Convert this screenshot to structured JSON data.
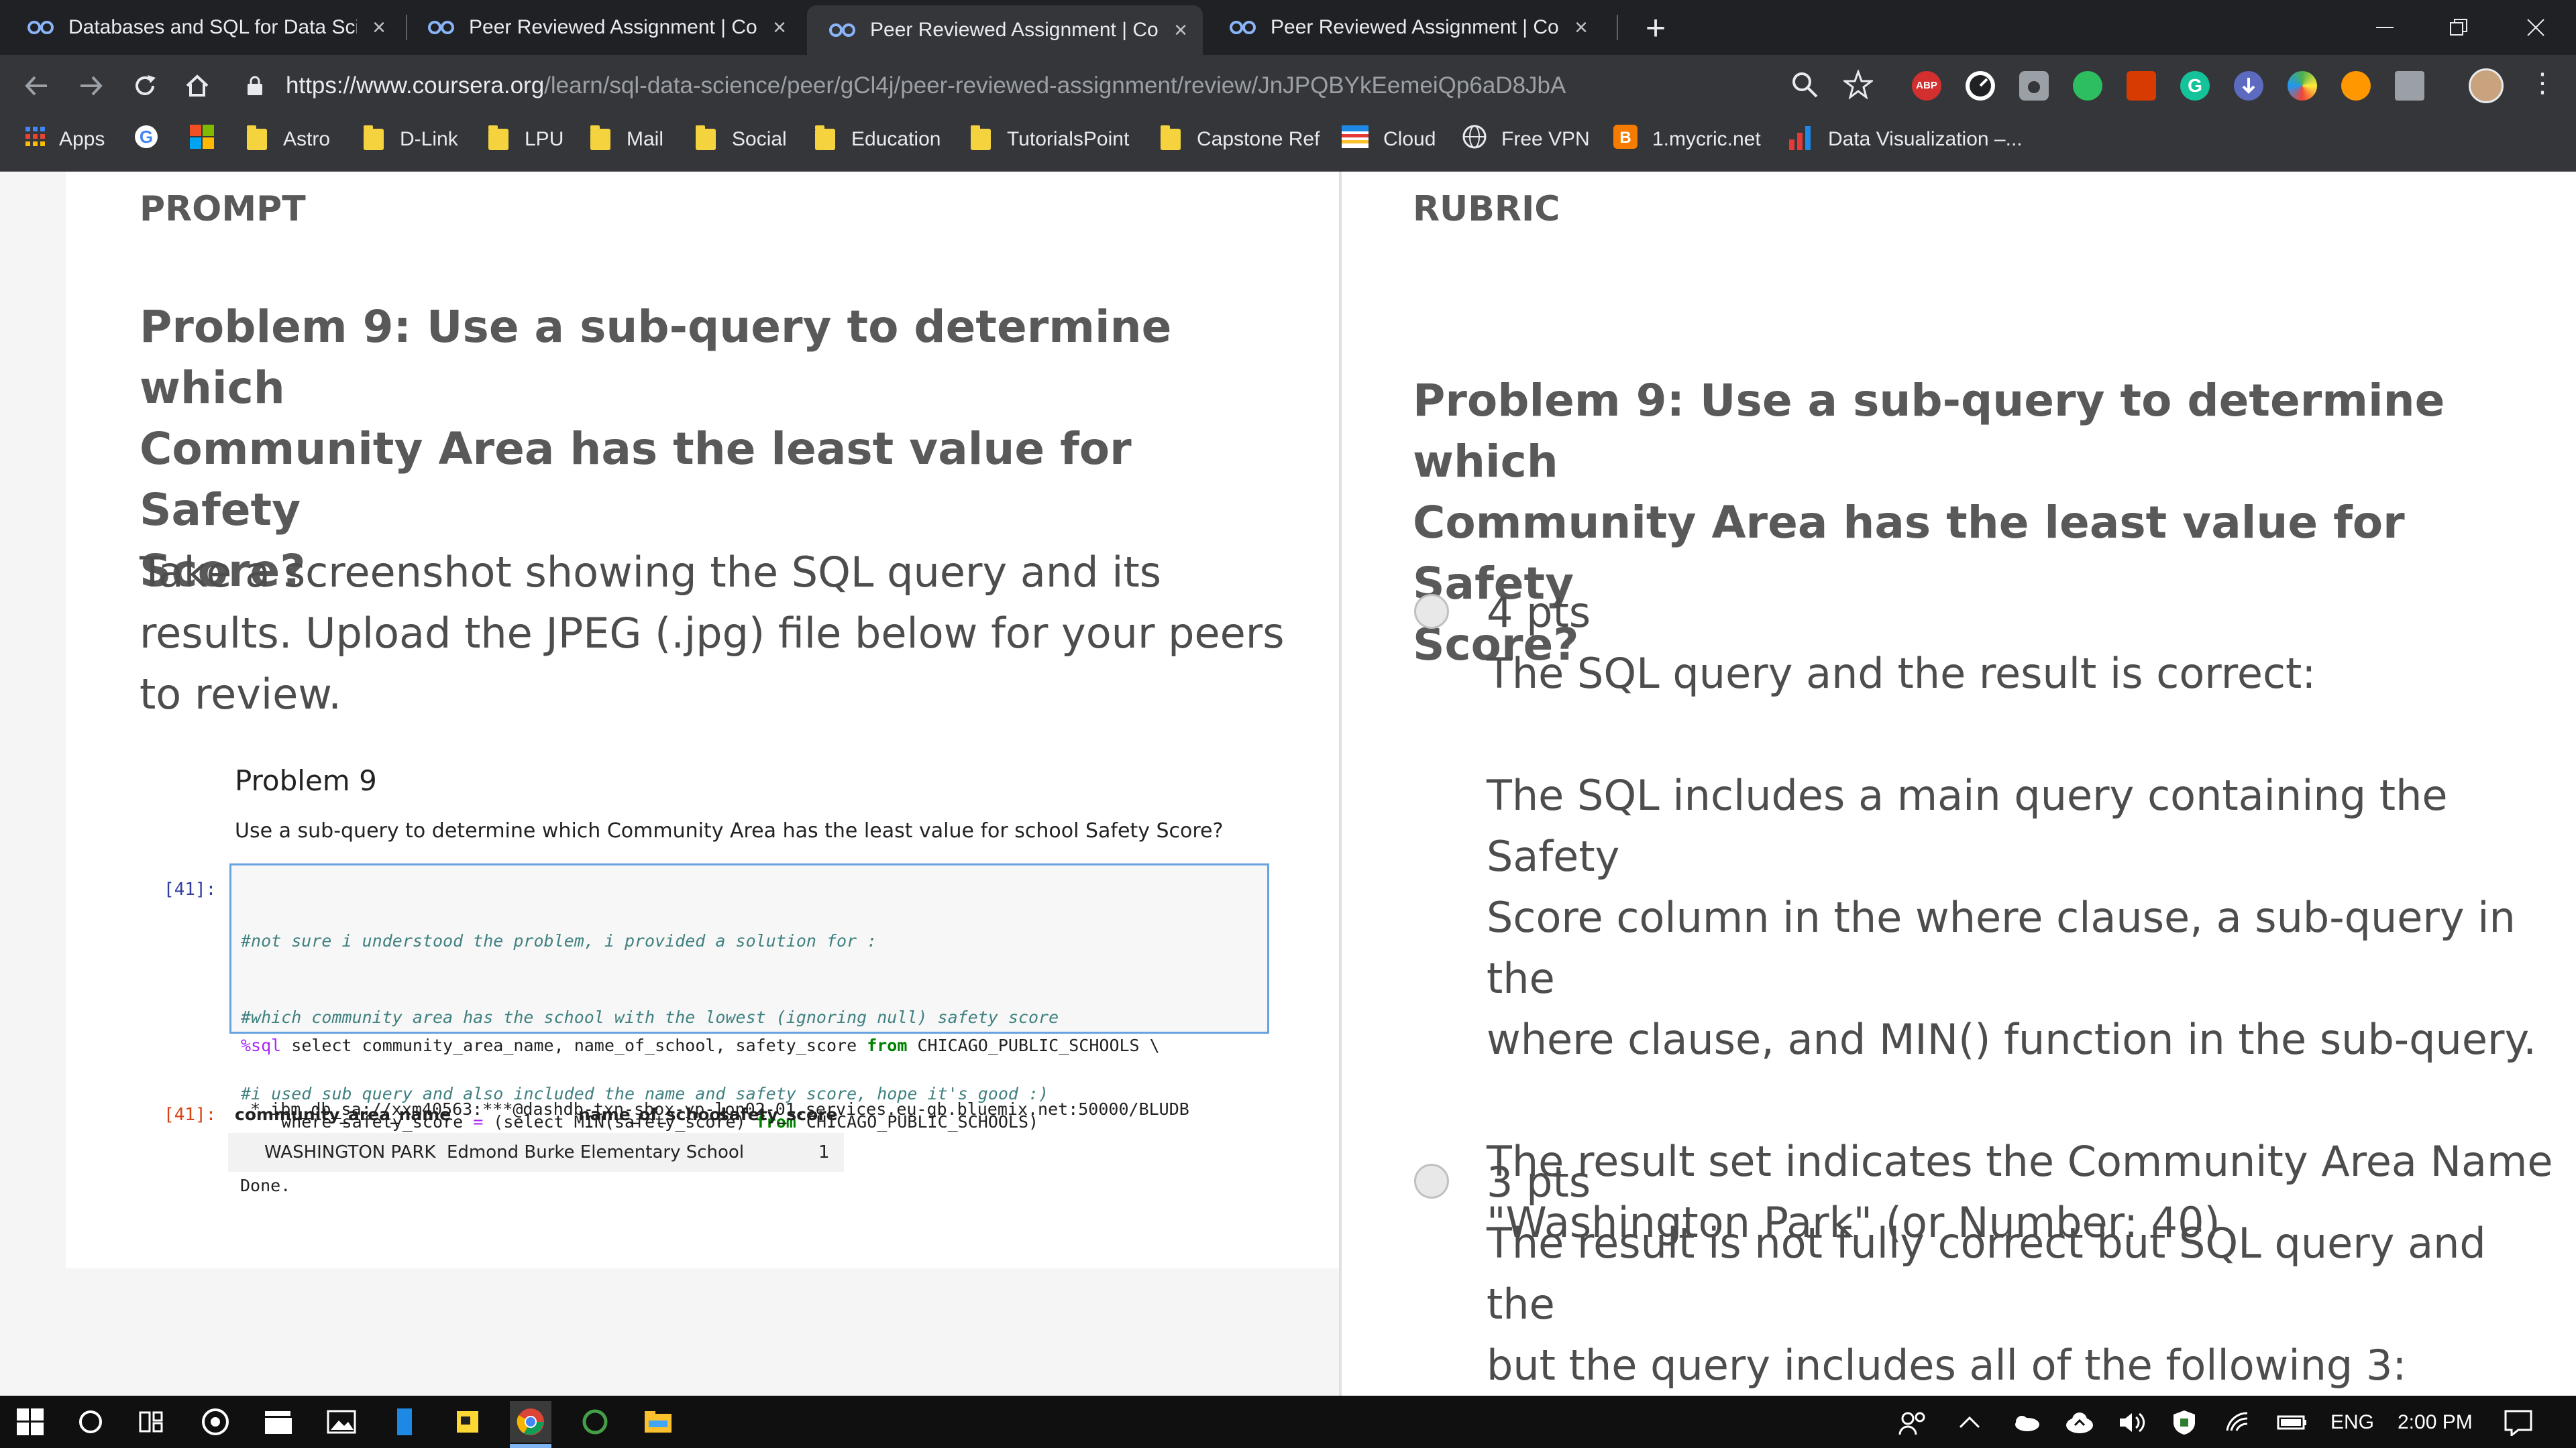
{
  "browser": {
    "tabs": [
      {
        "title": "Databases and SQL for Data Scie",
        "active": false
      },
      {
        "title": "Peer Reviewed Assignment | Cou",
        "active": false
      },
      {
        "title": "Peer Reviewed Assignment | Cou",
        "active": true
      },
      {
        "title": "Peer Reviewed Assignment | Cou",
        "active": false
      }
    ],
    "new_tab": "+",
    "url": {
      "host": "https://www.coursera.org",
      "path": "/learn/sql-data-science/peer/gCl4j/peer-reviewed-assignment/review/JnJPQBYkEemeiQp6aD8JbA"
    },
    "extensions": [
      "zoom-icon",
      "star-icon",
      "adblock-icon",
      "speedometer-icon",
      "camera-icon",
      "evernote-icon",
      "office-icon",
      "grammarly-icon",
      "download-icon",
      "color-icon",
      "pocket-icon",
      "drive-icon",
      "avatar"
    ],
    "abp_label": "ABP",
    "bookmarks": [
      {
        "label": "Apps",
        "icon": "apps-grid-icon"
      },
      {
        "label": "",
        "icon": "google-icon"
      },
      {
        "label": "",
        "icon": "microsoft-icon"
      },
      {
        "label": "Astro",
        "icon": "folder-icon"
      },
      {
        "label": "D-Link",
        "icon": "folder-icon"
      },
      {
        "label": "LPU",
        "icon": "folder-icon"
      },
      {
        "label": "Mail",
        "icon": "folder-icon"
      },
      {
        "label": "Social",
        "icon": "folder-icon"
      },
      {
        "label": "Education",
        "icon": "folder-icon"
      },
      {
        "label": "TutorialsPoint",
        "icon": "folder-icon"
      },
      {
        "label": "Capstone Ref",
        "icon": "folder-icon"
      },
      {
        "label": "Cloud",
        "icon": "cloud-bookmark-icon"
      },
      {
        "label": "Free VPN",
        "icon": "globe-icon"
      },
      {
        "label": "1.mycric.net",
        "icon": "blogger-icon"
      },
      {
        "label": "Data Visualization –...",
        "icon": "chart-icon"
      }
    ]
  },
  "prompt": {
    "label": "PROMPT",
    "title_lines": [
      "Problem 9: Use a sub-query to determine which",
      "Community Area has the least value for Safety",
      "Score?"
    ],
    "instruction_lines": [
      "Take a screenshot showing the SQL query and its",
      "results. Upload the JPEG (.jpg) file below for your peers",
      "to review."
    ]
  },
  "notebook": {
    "heading": "Problem 9",
    "question": "Use a sub-query to determine which Community Area has the least value for school Safety Score?",
    "in_prompt": "[41]:",
    "comments": [
      "#not sure i understood the problem, i provided a solution for :",
      "#which community area has the school with the lowest (ignoring null) safety score",
      "#i used sub query and also included the name and safety score, hope it's good :)"
    ],
    "code_line1": {
      "magic": "%sql",
      "a": " select community_area_name, name_of_school, safety_score ",
      "kw": "from",
      "b": " CHICAGO_PUBLIC_SCHOOLS \\"
    },
    "code_line2": {
      "a": "    where safety_score ",
      "eq": "=",
      "b": " (select MIN(safety_score) ",
      "kw": "from",
      "c": " CHICAGO_PUBLIC_SCHOOLS)"
    },
    "output_lines": [
      " * ibm_db_sa://xxm40563:***@dashdb-txn-sbox-yp-lon02-01.services.eu-gb.bluemix.net:50000/BLUDB",
      "Done."
    ],
    "out_prompt": "[41]:",
    "table": {
      "columns": [
        "community_area_name",
        "name_of_school",
        "safety_score"
      ],
      "rows": [
        [
          "WASHINGTON PARK",
          "Edmond Burke Elementary School",
          "1"
        ]
      ]
    }
  },
  "rubric": {
    "label": "RUBRIC",
    "title_lines": [
      "Problem 9: Use a sub-query to determine which",
      "Community Area has the least value for Safety",
      "Score?"
    ],
    "options": [
      {
        "points": "4 pts",
        "lines": [
          "The SQL query and the result is correct:",
          "",
          "The SQL includes a main query containing the Safety",
          "Score column in the where clause, a sub-query in the",
          "where clause, and MIN() function in the sub-query.",
          "",
          "The result set indicates the Community Area Name",
          "\"Washington Park\" (or Number: 40)"
        ]
      },
      {
        "points": "3 pts",
        "lines": [
          "The result is not fully correct but SQL query and the",
          "but the query includes all of the following 3:"
        ]
      }
    ]
  },
  "taskbar": {
    "lang": "ENG",
    "time": "2:00 PM"
  }
}
